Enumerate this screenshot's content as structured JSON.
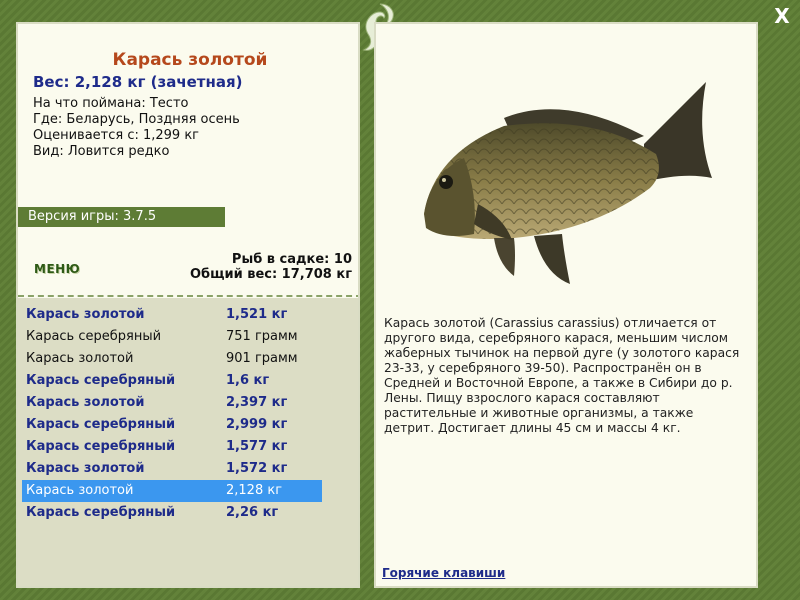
{
  "window": {
    "close_label": "X"
  },
  "catch": {
    "name": "Карась золотой",
    "weight_line": "Вес: 2,128 кг (зачетная)",
    "bait": "На что поймана: Тесто",
    "location": "Где: Беларусь, Поздняя осень",
    "min_weight": "Оценивается с: 1,299 кг",
    "rarity": "Вид: Ловится редко"
  },
  "version": "Версия игры: 3.7.5",
  "menu_label": "МЕНЮ",
  "keepnet": {
    "count": "Рыб в садке: 10",
    "total_weight": "Общий вес: 17,708 кг"
  },
  "fish_list": [
    {
      "name": "Карась золотой",
      "weight": "1,521 кг"
    },
    {
      "name": "Карась серебряный",
      "weight": "751 грамм"
    },
    {
      "name": "Карась золотой",
      "weight": "901 грамм"
    },
    {
      "name": "Карась серебряный",
      "weight": "1,6 кг"
    },
    {
      "name": "Карась золотой",
      "weight": "2,397 кг"
    },
    {
      "name": "Карась серебряный",
      "weight": "2,999 кг"
    },
    {
      "name": "Карась серебряный",
      "weight": "1,577 кг"
    },
    {
      "name": "Карась золотой",
      "weight": "1,572 кг"
    },
    {
      "name": "Карась золотой",
      "weight": "2,128 кг"
    },
    {
      "name": "Карась серебряный",
      "weight": "2,26 кг"
    }
  ],
  "description": "Карась золотой (Carassius carassius) отличается от другого вида, серебряного карася, меньшим числом жаберных тычинок на первой дуге (у золотого карася 23-33, у серебряного 39-50). Распространён он в Средней и Восточной Европе, а также в Сибири до р. Лены. Пищу взрослого карася составляют растительные и животные организмы, а также детрит. Достигает длины 45 см и массы 4 кг.",
  "hotkeys_link": "Горячие клавиши",
  "colors": {
    "frame_green": "#5b7a34",
    "panel_bg": "#fbfbee",
    "list_bg": "#dcddc5",
    "title_orange": "#b5481c",
    "trophy_blue": "#1e2b8a",
    "selection_blue": "#3b97ef"
  },
  "icons": {
    "close": "close-icon",
    "decoration": "fish-swirl-icon",
    "fish_image": "crucian-carp-image"
  }
}
